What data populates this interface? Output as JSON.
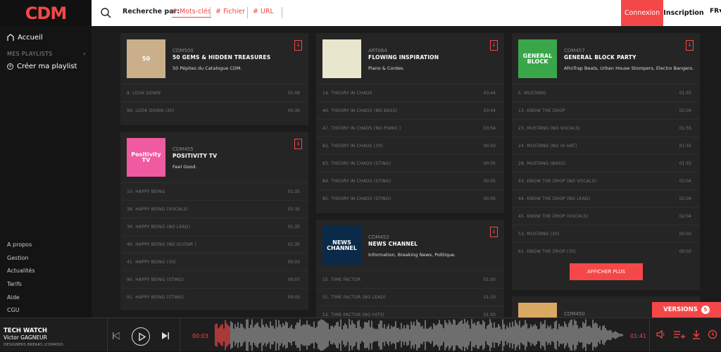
{
  "topbar": {
    "logo": "CDM",
    "search_label": "Recherche par:",
    "filters": [
      "# Mots-clés",
      "# Fichier",
      "# URL"
    ],
    "connexion": "Connexion",
    "inscription": "Inscription",
    "lang": "FR"
  },
  "sidebar": {
    "home": "Accueil",
    "playlists_label": "MES PLAYLISTS",
    "create_playlist": "Créer ma playlist",
    "footer": [
      "A propos",
      "Gestion",
      "Actualités",
      "Tarifs",
      "Aide",
      "CGU"
    ]
  },
  "albums": [
    {
      "code": "CDM500",
      "title": "50 GEMS & HIDDEN TREASURES",
      "desc": "50 Pépites du Catalogue CDM.",
      "cover_label": "50",
      "cover_color": "#c9b08a",
      "tracks": [
        {
          "name": "9.  LOOK DOWN",
          "dur": "01:09"
        },
        {
          "name": "99.  LOOK DOWN (30)",
          "dur": "00:30"
        }
      ]
    },
    {
      "code": "CDM455",
      "title": "POSITIVITY TV",
      "desc": "Feel Good.",
      "cover_label": "Positivity TV",
      "cover_color": "#f05aa0",
      "tracks": [
        {
          "name": "10.  HAPPY BEING",
          "dur": "01:35"
        },
        {
          "name": "38.  HAPPY BEING (VOCALS)",
          "dur": "01:35"
        },
        {
          "name": "39.  HAPPY BEING (NO LEAD)",
          "dur": "01:35"
        },
        {
          "name": "40.  HAPPY BEING (NO GUITAR )",
          "dur": "01:35"
        },
        {
          "name": "41.  HAPPY BEING (30)",
          "dur": "00:03"
        },
        {
          "name": "90.  HAPPY BEING (STING)",
          "dur": "00:07"
        },
        {
          "name": "91.  HAPPY BEING (STING)",
          "dur": "00:05"
        }
      ]
    },
    {
      "code": "ART064",
      "title": "FLOWING INSPIRATION",
      "desc": "Piano & Cordes.",
      "cover_label": "",
      "cover_color": "#e8e6cc",
      "tracks": [
        {
          "name": "14.  THEORY IN CHAOS",
          "dur": "03:44"
        },
        {
          "name": "46.  THEORY IN CHAOS (NO BASS)",
          "dur": "03:44"
        },
        {
          "name": "47.  THEORY IN CHAOS (NO PIANO )",
          "dur": "03:04"
        },
        {
          "name": "82.  THEORY IN CHAOS (30)",
          "dur": "00:03"
        },
        {
          "name": "83.  THEORY IN CHAOS (STING)",
          "dur": "00:05"
        },
        {
          "name": "84.  THEORY IN CHAOS (STING)",
          "dur": "00:05"
        },
        {
          "name": "85.  THEORY IN CHAOS (STING)",
          "dur": "00:05"
        }
      ]
    },
    {
      "code": "CDM452",
      "title": "NEWS CHANNEL",
      "desc": "Information, Breaking News, Politique.",
      "cover_label": "NEWS CHANNEL",
      "cover_color": "#0b2a4a",
      "tracks": [
        {
          "name": "15.  TIME FACTOR",
          "dur": "01:50"
        },
        {
          "name": "51.  TIME FACTOR (NO LEAD)",
          "dur": "01:10"
        },
        {
          "name": "52.  TIME FACTOR (NO HITS)",
          "dur": "01:50"
        }
      ]
    },
    {
      "code": "CDM457",
      "title": "GENERAL BLOCK PARTY",
      "desc": "AfroTrap Beats, Urban House Stompers, Electro Bangers.",
      "cover_label": "GENERAL BLOCK",
      "cover_color": "#3aa64a",
      "tracks": [
        {
          "name": "5.  MUSTANG",
          "dur": "01:55"
        },
        {
          "name": "13.  KNOW THE DROP",
          "dur": "02:04"
        },
        {
          "name": "23.  MUSTANG (NO VOCALS)",
          "dur": "01:55"
        },
        {
          "name": "24.  MUSTANG (NO HI HAT)",
          "dur": "01:55"
        },
        {
          "name": "28.  MUSTANG (BASS)",
          "dur": "01:55"
        },
        {
          "name": "43.  KNOW THE DROP (NO VOCALS)",
          "dur": "02:04"
        },
        {
          "name": "44.  KNOW THE DROP (NO LEAD)",
          "dur": "02:04"
        },
        {
          "name": "45.  KNOW THE DROP (VOCALS)",
          "dur": "02:04"
        },
        {
          "name": "53.  MUSTANG (30)",
          "dur": "00:03"
        },
        {
          "name": "61.  KNOW THE DROP (30)",
          "dur": "00:03"
        }
      ],
      "more": "AFFICHER PLUS"
    },
    {
      "code": "CDM450",
      "title": "",
      "desc": "",
      "cover_label": "",
      "cover_color": "#d9a862",
      "tracks": []
    }
  ],
  "versions": {
    "label": "VERSIONS",
    "count": "5"
  },
  "player": {
    "title": "TECH WATCH",
    "artist": "Victor GAGNEUR",
    "sub": "DESIGNERS BREAKS (CDM450)",
    "current_time": "00:03",
    "total_time": "01:41",
    "progress": 0.03
  },
  "colors": {
    "accent": "#f44848"
  }
}
